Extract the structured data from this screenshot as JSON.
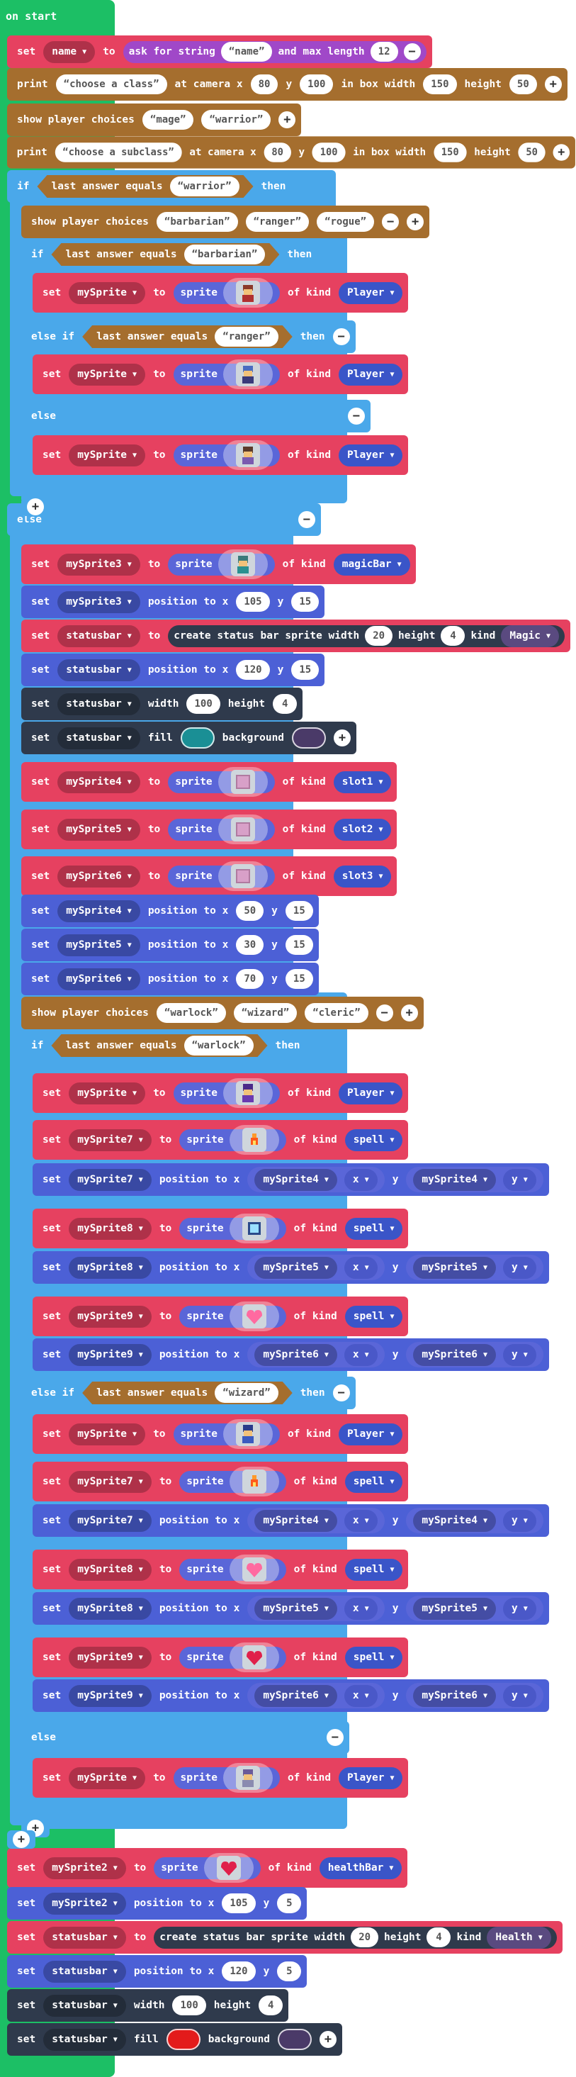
{
  "colors": {
    "event": "#1cbf65",
    "variables": "#e64160",
    "game": "#a56e2e",
    "logic": "#4aa8ea",
    "sprites": "#4c60d6",
    "statusbars": "#2f3a4c",
    "controller": "#2b8ee6"
  },
  "event": {
    "label": "on start"
  },
  "kw": {
    "set": "set",
    "to": "to",
    "print": "print",
    "show_choices": "show player choices",
    "if": "if",
    "then": "then",
    "else": "else",
    "else_if": "else if",
    "last_answer_equals": "last answer equals",
    "sprite": "sprite",
    "of_kind": "of kind",
    "position_to_x": "position to x",
    "y": "y",
    "x": "x",
    "ask_for_string": "ask for string",
    "and_max_length": "and max length",
    "at_camera_x": "at camera x",
    "in_box_width": "in box width",
    "height": "height",
    "create_status_bar": "create status bar sprite width",
    "kind": "kind",
    "width": "width",
    "fill": "fill",
    "background": "background"
  },
  "b1": {
    "var": "name",
    "prompt": "name",
    "max": "12"
  },
  "b2": {
    "text": "choose a class",
    "x": "80",
    "y": "100",
    "w": "150",
    "h": "50"
  },
  "b3": {
    "c1": "mage",
    "c2": "warrior"
  },
  "b4": {
    "text": "choose a subclass",
    "x": "80",
    "y": "100",
    "w": "150",
    "h": "50"
  },
  "b5": {
    "eq": "warrior"
  },
  "b6": {
    "c1": "barbarian",
    "c2": "ranger",
    "c3": "rogue"
  },
  "b7": {
    "eq": "barbarian"
  },
  "b8": {
    "var": "mySprite",
    "kind": "Player"
  },
  "b9": {
    "eq": "ranger"
  },
  "b10": {
    "var": "mySprite",
    "kind": "Player"
  },
  "b11": {
    "var": "mySprite",
    "kind": "Player"
  },
  "b12": {
    "var": "mySprite3",
    "kind": "magicBar"
  },
  "b13": {
    "var": "mySprite3",
    "x": "105",
    "y": "15"
  },
  "b14": {
    "var": "statusbar",
    "w": "20",
    "h": "4",
    "kind": "Magic"
  },
  "b15": {
    "var": "statusbar",
    "x": "120",
    "y": "15"
  },
  "b16": {
    "var": "statusbar",
    "w": "100",
    "h": "4"
  },
  "b17": {
    "var": "statusbar",
    "fill": "#1a8f95",
    "bg": "#4a3a68"
  },
  "b18": {
    "var": "mySprite4",
    "kind": "slot1"
  },
  "b19": {
    "var": "mySprite5",
    "kind": "slot2"
  },
  "b20": {
    "var": "mySprite6",
    "kind": "slot3"
  },
  "b21": {
    "var": "mySprite4",
    "x": "50",
    "y": "15"
  },
  "b22": {
    "var": "mySprite5",
    "x": "30",
    "y": "15"
  },
  "b23": {
    "var": "mySprite6",
    "x": "70",
    "y": "15"
  },
  "b24": {
    "c1": "warlock",
    "c2": "wizard",
    "c3": "cleric"
  },
  "b25": {
    "eq": "warlock"
  },
  "b26": {
    "var": "mySprite",
    "kind": "Player"
  },
  "b27": {
    "var": "mySprite7",
    "kind": "spell"
  },
  "b28": {
    "var": "mySprite7",
    "sx": "mySprite4",
    "sy": "mySprite4",
    "px": "x",
    "py": "y"
  },
  "b29": {
    "var": "mySprite8",
    "kind": "spell"
  },
  "b30": {
    "var": "mySprite8",
    "sx": "mySprite5",
    "sy": "mySprite5",
    "px": "x",
    "py": "y"
  },
  "b31": {
    "var": "mySprite9",
    "kind": "spell"
  },
  "b32": {
    "var": "mySprite9",
    "sx": "mySprite6",
    "sy": "mySprite6",
    "px": "x",
    "py": "y"
  },
  "b33": {
    "eq": "wizard"
  },
  "b34": {
    "var": "mySprite",
    "kind": "Player"
  },
  "b35": {
    "var": "mySprite7",
    "kind": "spell"
  },
  "b36": {
    "var": "mySprite7",
    "sx": "mySprite4",
    "sy": "mySprite4",
    "px": "x",
    "py": "y"
  },
  "b37": {
    "var": "mySprite8",
    "kind": "spell"
  },
  "b38": {
    "var": "mySprite8",
    "sx": "mySprite5",
    "sy": "mySprite5",
    "px": "x",
    "py": "y"
  },
  "b39": {
    "var": "mySprite9",
    "kind": "spell"
  },
  "b40": {
    "var": "mySprite9",
    "sx": "mySprite6",
    "sy": "mySprite6",
    "px": "x",
    "py": "y"
  },
  "b41": {
    "var": "mySprite",
    "kind": "Player"
  },
  "b42": {
    "var": "mySprite2",
    "kind": "healthBar"
  },
  "b43": {
    "var": "mySprite2",
    "x": "105",
    "y": "5"
  },
  "b44": {
    "var": "statusbar",
    "w": "20",
    "h": "4",
    "kind": "Health"
  },
  "b45": {
    "var": "statusbar",
    "x": "120",
    "y": "5"
  },
  "b46": {
    "var": "statusbar",
    "w": "100",
    "h": "4"
  },
  "b47": {
    "var": "statusbar",
    "fill": "#e31b1b",
    "bg": "#4a3a68"
  },
  "icons": {
    "dropdown": "caret-down-icon",
    "add": "plus-circle-icon",
    "remove": "minus-circle-icon",
    "sprite": "pixel-sprite-icon"
  }
}
